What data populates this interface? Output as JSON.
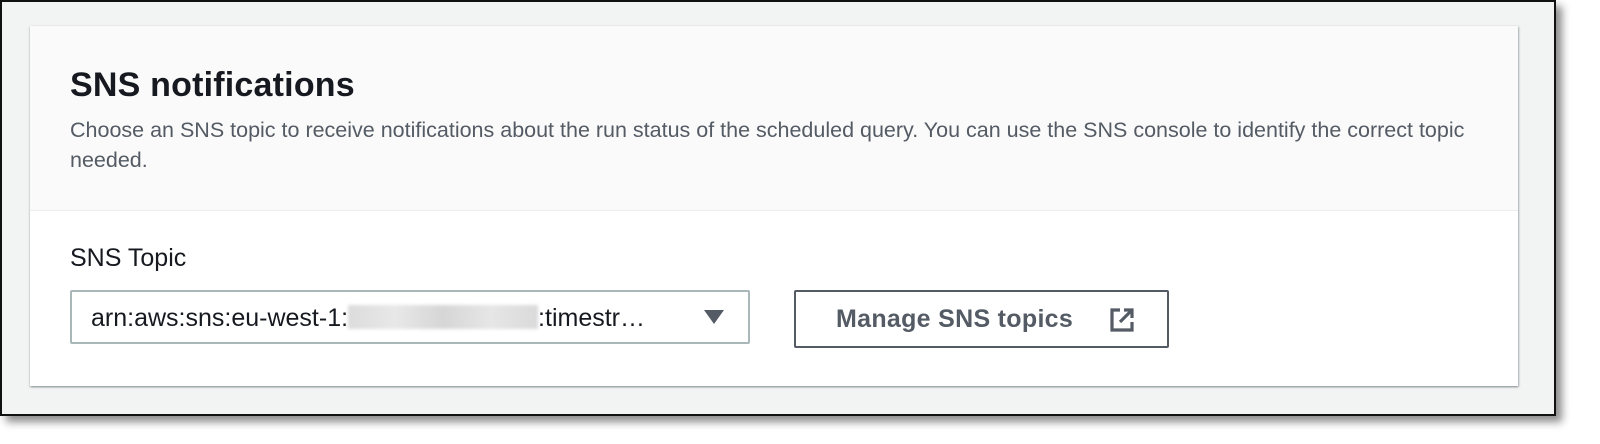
{
  "panel": {
    "title": "SNS notifications",
    "description": "Choose an SNS topic to receive notifications about the run status of the scheduled query. You can use the SNS console to identify the correct topic needed."
  },
  "sns_topic": {
    "label": "SNS Topic",
    "value_prefix": "arn:aws:sns:eu-west-1:",
    "value_suffix": ":timestr…",
    "account_id_redacted": true
  },
  "manage_button": {
    "label": "Manage SNS topics",
    "icon": "external-link-icon"
  },
  "colors": {
    "text_primary": "#16191f",
    "text_secondary": "#545b64",
    "input_border": "#aab7b8",
    "header_background": "#fafafa"
  }
}
